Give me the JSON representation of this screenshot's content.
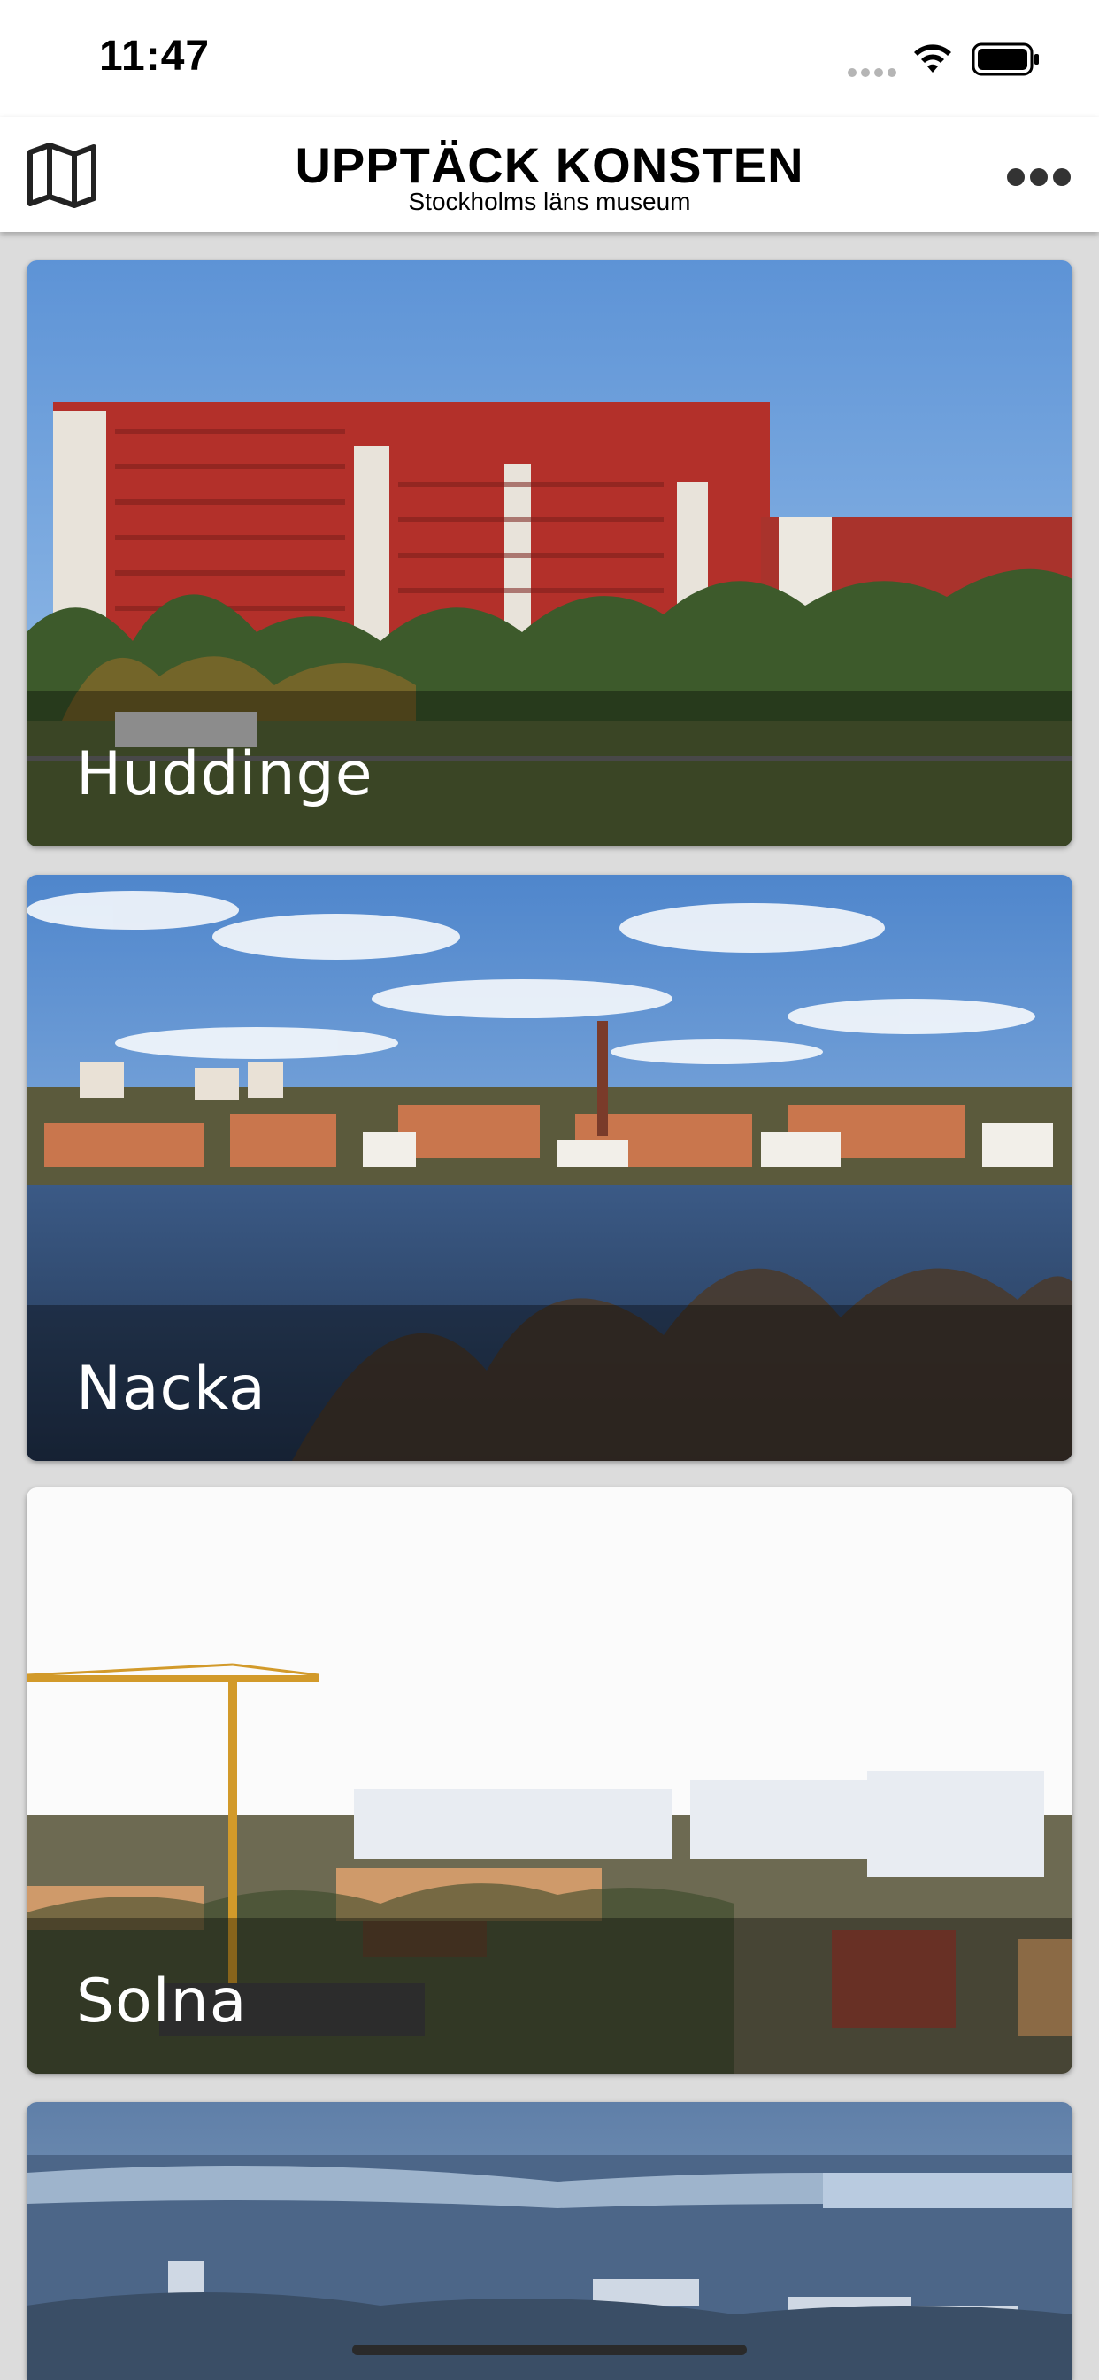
{
  "status_bar": {
    "time": "11:47"
  },
  "header": {
    "title": "UPPTÄCK KONSTEN",
    "subtitle": "Stockholms läns museum",
    "map_icon": "map-icon",
    "more_icon": "more-icon"
  },
  "places": [
    {
      "name": "Huddinge"
    },
    {
      "name": "Nacka"
    },
    {
      "name": "Solna"
    },
    {
      "name": ""
    }
  ]
}
